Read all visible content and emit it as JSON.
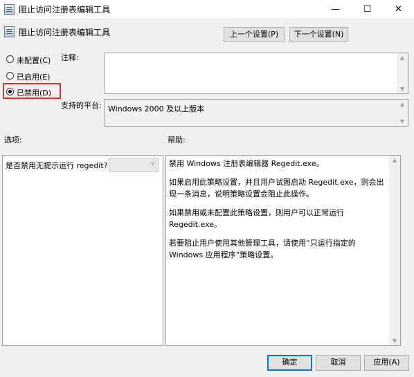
{
  "window": {
    "title": "阻止访问注册表编辑工具",
    "minimize_glyph": "—",
    "maximize_glyph": "☐",
    "close_glyph": "✕"
  },
  "header": {
    "policy_name": "阻止访问注册表编辑工具",
    "prev_button": "上一个设置(P)",
    "next_button": "下一个设置(N)"
  },
  "state": {
    "options": [
      {
        "label": "未配置(C)",
        "selected": false
      },
      {
        "label": "已启用(E)",
        "selected": false
      },
      {
        "label": "已禁用(D)",
        "selected": true
      }
    ]
  },
  "comment": {
    "label": "注释:",
    "value": ""
  },
  "platform": {
    "label": "支持的平台:",
    "value": "Windows 2000 及以上版本"
  },
  "options_panel": {
    "label": "选项:",
    "option_text": "是否禁用无提示运行 regedit?",
    "dropdown_value": ""
  },
  "help_panel": {
    "label": "帮助:",
    "paragraphs": [
      "禁用 Windows 注册表编辑器 Regedit.exe。",
      "如果启用此策略设置，并且用户试图启动 Regedit.exe，则会出现一条消息，说明策略设置会阻止此操作。",
      "如果禁用或未配置此策略设置，则用户可以正常运行 Regedit.exe。",
      "若要阻止用户使用其他管理工具，请使用“只运行指定的 Windows 应用程序”策略设置。"
    ]
  },
  "footer": {
    "ok": "确定",
    "cancel": "取消",
    "apply": "应用(A)"
  },
  "colors": {
    "accent": "#0078d7",
    "highlight_border": "#d9312f"
  }
}
